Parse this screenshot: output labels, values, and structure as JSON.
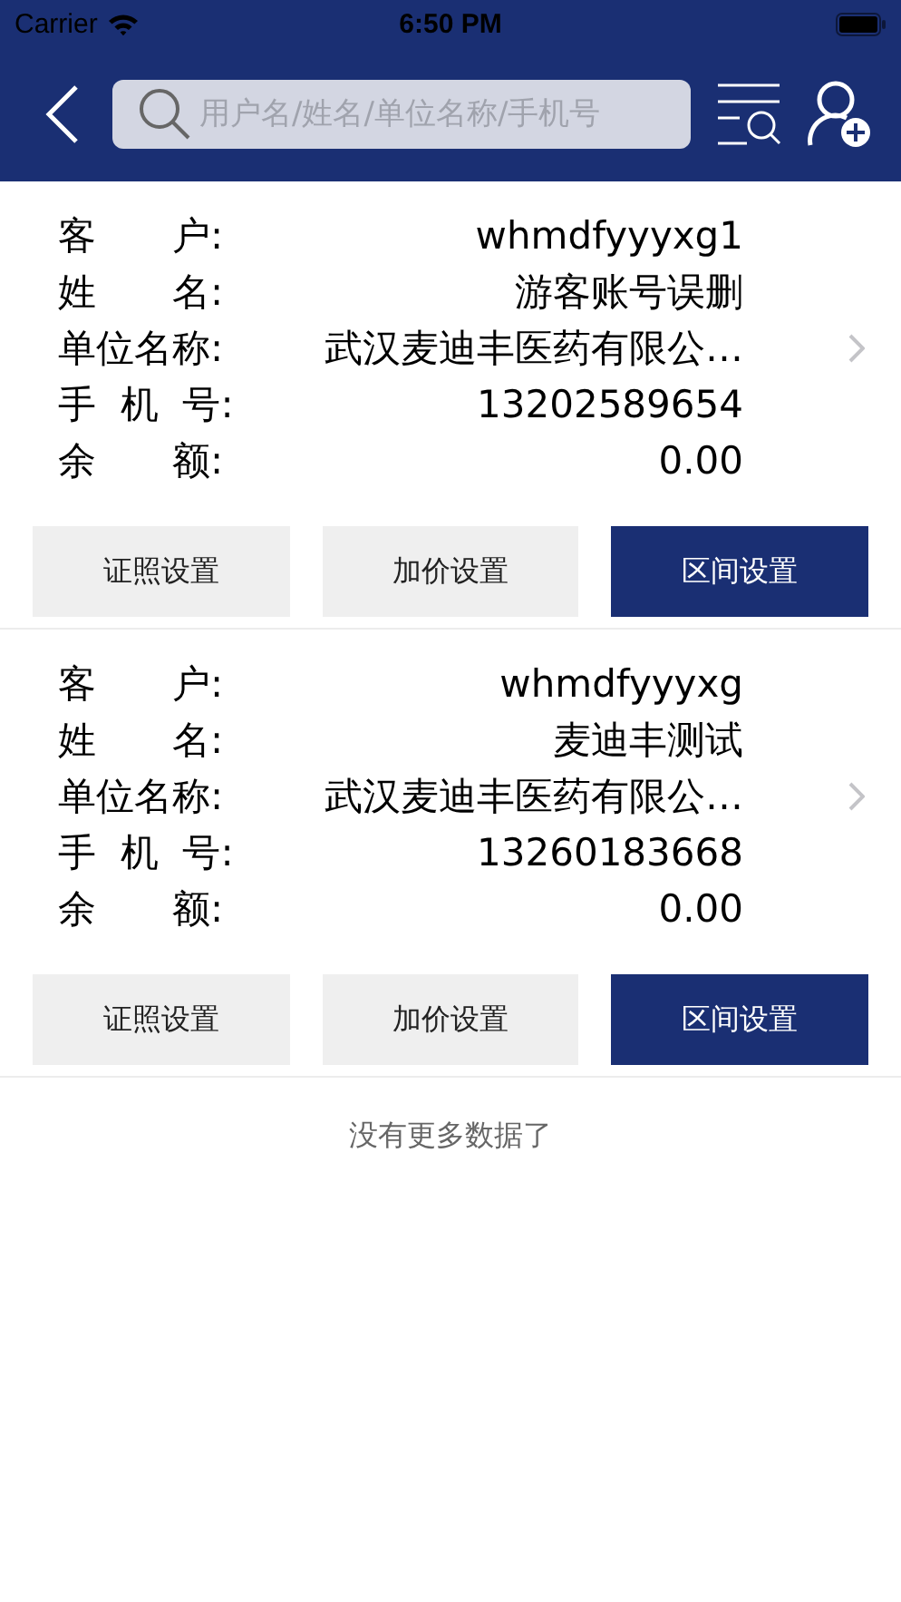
{
  "status_bar": {
    "carrier": "Carrier",
    "time": "6:50 PM"
  },
  "search": {
    "placeholder": "用户名/姓名/单位名称/手机号"
  },
  "customers": [
    {
      "fields": [
        {
          "label": "客　　户:",
          "value": "whmdfyyyxg1"
        },
        {
          "label": "姓　　名:",
          "value": "游客账号误删"
        },
        {
          "label": "单位名称:",
          "value": "武汉麦迪丰医药有限公…"
        },
        {
          "label": "手  机  号:",
          "value": "13202589654"
        },
        {
          "label": "余　　额:",
          "value": "0.00"
        }
      ],
      "buttons": [
        {
          "label": "证照设置",
          "kind": "secondary"
        },
        {
          "label": "加价设置",
          "kind": "secondary"
        },
        {
          "label": "区间设置",
          "kind": "primary"
        }
      ]
    },
    {
      "fields": [
        {
          "label": "客　　户:",
          "value": "whmdfyyyxg"
        },
        {
          "label": "姓　　名:",
          "value": "麦迪丰测试"
        },
        {
          "label": "单位名称:",
          "value": "武汉麦迪丰医药有限公…"
        },
        {
          "label": "手  机  号:",
          "value": "13260183668"
        },
        {
          "label": "余　　额:",
          "value": "0.00"
        }
      ],
      "buttons": [
        {
          "label": "证照设置",
          "kind": "secondary"
        },
        {
          "label": "加价设置",
          "kind": "secondary"
        },
        {
          "label": "区间设置",
          "kind": "primary"
        }
      ]
    }
  ],
  "footer": "没有更多数据了"
}
